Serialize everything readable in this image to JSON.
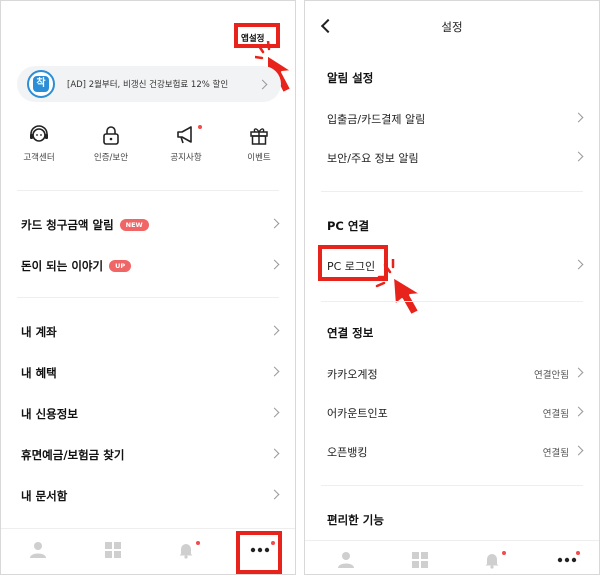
{
  "left": {
    "app_settings_label": "앱설정",
    "ad_banner": {
      "logo_text": "착",
      "text": "[AD] 2월부터, 비갱신 건강보험료 12% 할인"
    },
    "quick_menu": [
      {
        "icon": "headset-icon",
        "label": "고객센터"
      },
      {
        "icon": "lock-icon",
        "label": "인증/보안"
      },
      {
        "icon": "megaphone-icon",
        "label": "공지사항"
      },
      {
        "icon": "gift-icon",
        "label": "이벤트"
      }
    ],
    "menu_top": [
      {
        "label": "카드 청구금액 알림",
        "badge": "NEW"
      },
      {
        "label": "돈이 되는 이야기",
        "badge": "UP"
      }
    ],
    "menu_list": [
      {
        "label": "내 계좌"
      },
      {
        "label": "내 혜택"
      },
      {
        "label": "내 신용정보"
      },
      {
        "label": "휴면예금/보험금 찾기"
      },
      {
        "label": "내 문서함"
      }
    ]
  },
  "right": {
    "header_title": "설정",
    "sections": [
      {
        "title": "알림 설정",
        "items": [
          {
            "label": "입출금/카드결제 알림"
          },
          {
            "label": "보안/주요 정보 알림"
          }
        ]
      },
      {
        "title": "PC 연결",
        "items": [
          {
            "label": "PC 로그인"
          }
        ]
      },
      {
        "title": "연결 정보",
        "items": [
          {
            "label": "카카오계정",
            "status": "연결안됨"
          },
          {
            "label": "어카운트인포",
            "status": "연결됨"
          },
          {
            "label": "오픈뱅킹",
            "status": "연결됨"
          }
        ]
      },
      {
        "title": "편리한 기능",
        "items": []
      }
    ]
  },
  "bottom_nav": [
    {
      "icon": "person-icon"
    },
    {
      "icon": "grid-icon"
    },
    {
      "icon": "bell-icon"
    },
    {
      "icon": "more-icon"
    }
  ],
  "colors": {
    "highlight": "#e8231b",
    "badge": "#f06565",
    "dot": "#f24b4b"
  }
}
